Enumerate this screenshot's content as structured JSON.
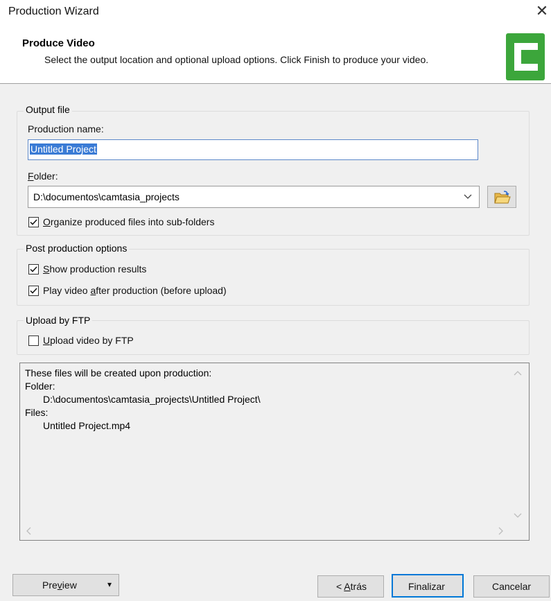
{
  "window": {
    "title": "Production Wizard",
    "close_glyph": "✕"
  },
  "header": {
    "title": "Produce Video",
    "subtitle": "Select the output location and optional upload options. Click Finish to produce your video.",
    "logo_icon": "camtasia-logo-icon",
    "logo_color": "#3ca63b"
  },
  "output_file": {
    "group_label": "Output file",
    "production_name_label": "Production name:",
    "production_name_value": "Untitled Project",
    "folder_label_accel": "F",
    "folder_label_rest": "older:",
    "folder_value": "D:\\documentos\\camtasia_projects",
    "organize_checked": true,
    "organize_accel": "O",
    "organize_rest": "rganize produced files into sub-folders"
  },
  "post_production": {
    "group_label": "Post production options",
    "show_results_checked": true,
    "show_results_accel": "S",
    "show_results_rest": "how production results",
    "play_video_checked": true,
    "play_video_pre": "Play video ",
    "play_video_accel": "a",
    "play_video_post": "fter production (before upload)"
  },
  "upload": {
    "group_label": "Upload by FTP",
    "upload_checked": false,
    "upload_accel": "U",
    "upload_rest": "pload video by FTP"
  },
  "info": {
    "line1": "These files will be created upon production:",
    "line2": "Folder:",
    "line3": "D:\\documentos\\camtasia_projects\\Untitled Project\\",
    "line4": "Files:",
    "line5": "Untitled Project.mp4"
  },
  "buttons": {
    "preview_pre": "Pre",
    "preview_accel": "v",
    "preview_post": "iew",
    "preview_arrow": "▾",
    "back_pre": "< ",
    "back_accel": "A",
    "back_post": "trás",
    "finish": "Finalizar",
    "cancel": "Cancelar"
  },
  "colors": {
    "accent": "#0078d7",
    "selection": "#3a7bd5",
    "panel_bg": "#f0f0f0"
  }
}
